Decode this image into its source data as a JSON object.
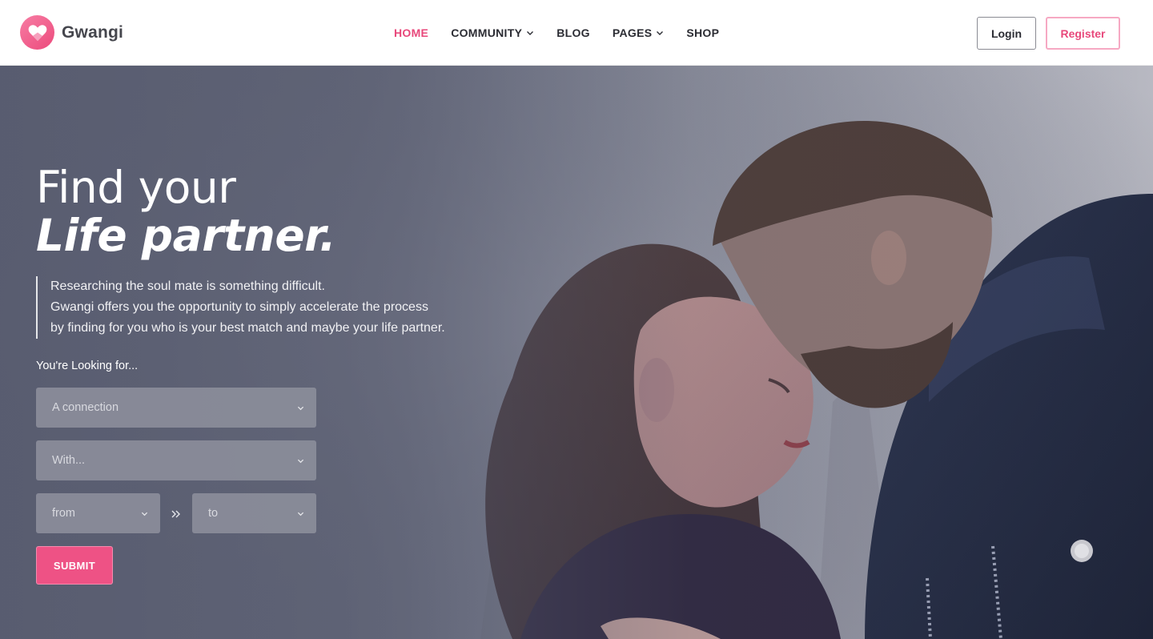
{
  "brand": {
    "name": "Gwangi",
    "accent": "#e8487b",
    "icon": "heart-icon"
  },
  "nav": {
    "items": [
      {
        "label": "HOME",
        "active": true,
        "dropdown": false
      },
      {
        "label": "COMMUNITY",
        "active": false,
        "dropdown": true
      },
      {
        "label": "BLOG",
        "active": false,
        "dropdown": false
      },
      {
        "label": "PAGES",
        "active": false,
        "dropdown": true
      },
      {
        "label": "SHOP",
        "active": false,
        "dropdown": false
      }
    ],
    "login_label": "Login",
    "register_label": "Register"
  },
  "hero": {
    "headline_line1": "Find your",
    "headline_line2": "Life partner.",
    "intro_lines": [
      "Researching the soul mate is something difficult.",
      "Gwangi offers you the opportunity to simply accelerate the process",
      "by finding for you who is your best match and maybe your life partner."
    ],
    "image": "couple-photo"
  },
  "search": {
    "label": "You're Looking for...",
    "connection_value": "A connection",
    "with_value": "With...",
    "age_from_value": "from",
    "age_to_value": "to",
    "submit_label": "SUBMIT"
  }
}
